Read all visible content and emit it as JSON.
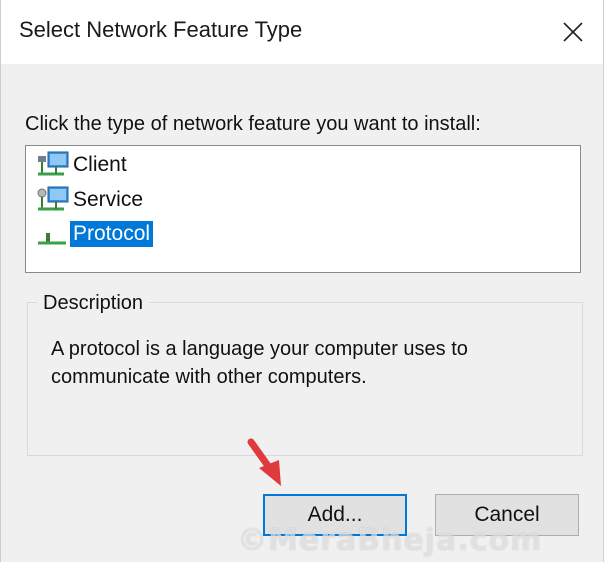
{
  "window": {
    "title": "Select Network Feature Type",
    "close_icon": "close-icon"
  },
  "prompt": "Click the type of network feature you want to install:",
  "feature_list": {
    "items": [
      {
        "label": "Client",
        "icon": "client-network-icon",
        "selected": false
      },
      {
        "label": "Service",
        "icon": "service-network-icon",
        "selected": false
      },
      {
        "label": "Protocol",
        "icon": "protocol-network-icon",
        "selected": true
      }
    ]
  },
  "description": {
    "legend": "Description",
    "text": "A protocol is a language your computer uses to communicate with other computers."
  },
  "buttons": {
    "add_label": "Add...",
    "cancel_label": "Cancel"
  },
  "annotation": {
    "icon": "red-arrow-icon",
    "color": "#e03a3e"
  },
  "watermark": "©MeraBheja.com",
  "colors": {
    "selection": "#0078d7",
    "default_button_border": "#0078d7",
    "dialog_background": "#f0f0f0"
  }
}
